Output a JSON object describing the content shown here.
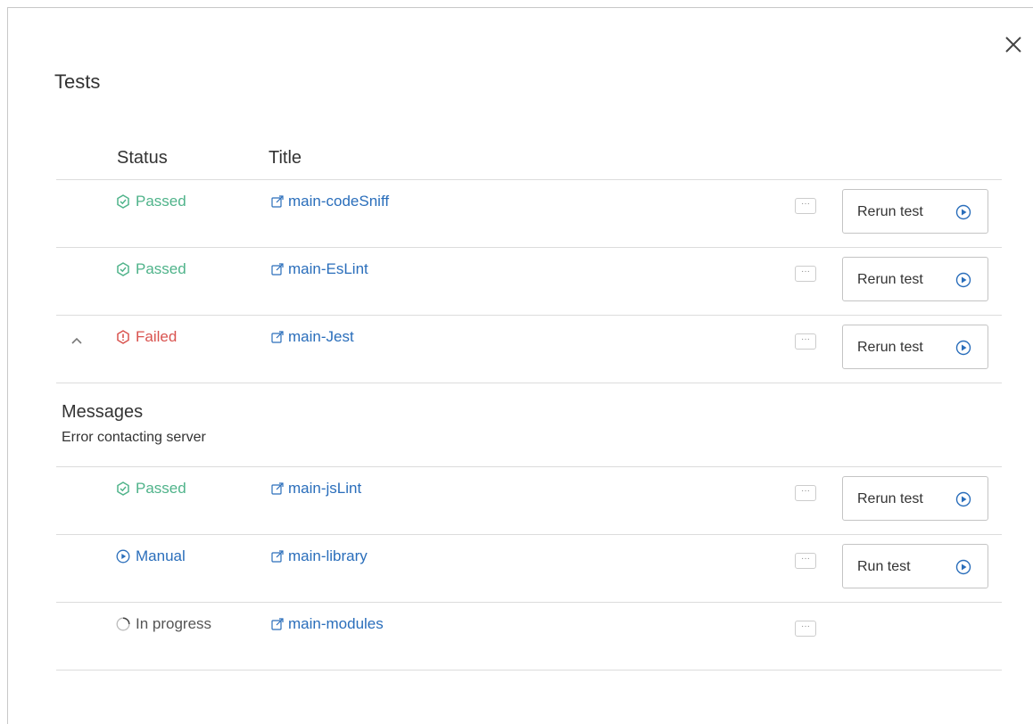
{
  "dialog": {
    "title": "Tests",
    "close_icon": "close-icon"
  },
  "table": {
    "headers": {
      "status": "Status",
      "title": "Title"
    },
    "rows": [
      {
        "status": "Passed",
        "status_type": "passed",
        "title": "main-codeSniff",
        "action": "Rerun test"
      },
      {
        "status": "Passed",
        "status_type": "passed",
        "title": "main-EsLint",
        "action": "Rerun test"
      },
      {
        "status": "Failed",
        "status_type": "failed",
        "title": "main-Jest",
        "action": "Rerun test",
        "expanded": true
      },
      {
        "status": "Passed",
        "status_type": "passed",
        "title": "main-jsLint",
        "action": "Rerun test"
      },
      {
        "status": "Manual",
        "status_type": "manual",
        "title": "main-library",
        "action": "Run test"
      },
      {
        "status": "In progress",
        "status_type": "inprogress",
        "title": "main-modules",
        "action": ""
      }
    ]
  },
  "messages": {
    "heading": "Messages",
    "text": "Error contacting server"
  },
  "colors": {
    "passed": "#4fb38a",
    "failed": "#d9534f",
    "link": "#2a6ebb",
    "border": "#dcdcdc"
  },
  "icons": {
    "more": "more-icon",
    "play": "play-circle-icon",
    "external": "external-link-icon",
    "caret": "chevron-up-icon"
  }
}
